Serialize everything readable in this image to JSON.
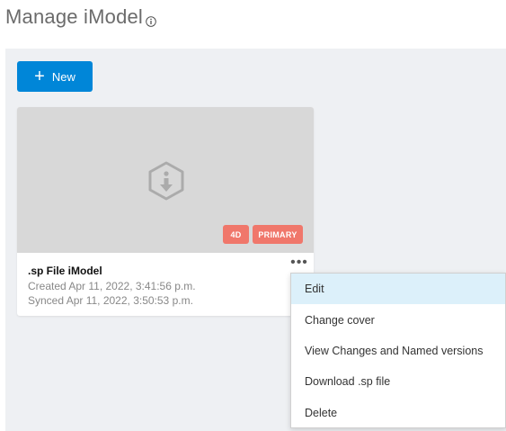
{
  "page": {
    "title": "Manage iModel"
  },
  "toolbar": {
    "new_label": "New"
  },
  "card": {
    "name": ".sp File iModel",
    "created": "Created Apr 11, 2022, 3:41:56 p.m.",
    "synced": "Synced Apr 11, 2022, 3:50:53 p.m.",
    "badges": [
      "4D",
      "PRIMARY"
    ],
    "more_label": "•••"
  },
  "menu": {
    "items": [
      {
        "label": "Edit",
        "active": true
      },
      {
        "label": "Change cover"
      },
      {
        "label": "View Changes and Named versions"
      },
      {
        "label": "Download .sp file"
      },
      {
        "label": "Delete"
      }
    ]
  },
  "colors": {
    "accent": "#0086d8",
    "badge": "#f0776b",
    "menu_hover": "#dcf0fa",
    "panel_bg": "#eef0f3"
  },
  "icons": [
    "info-icon",
    "plus-icon",
    "imodel-placeholder-icon",
    "more-icon"
  ]
}
